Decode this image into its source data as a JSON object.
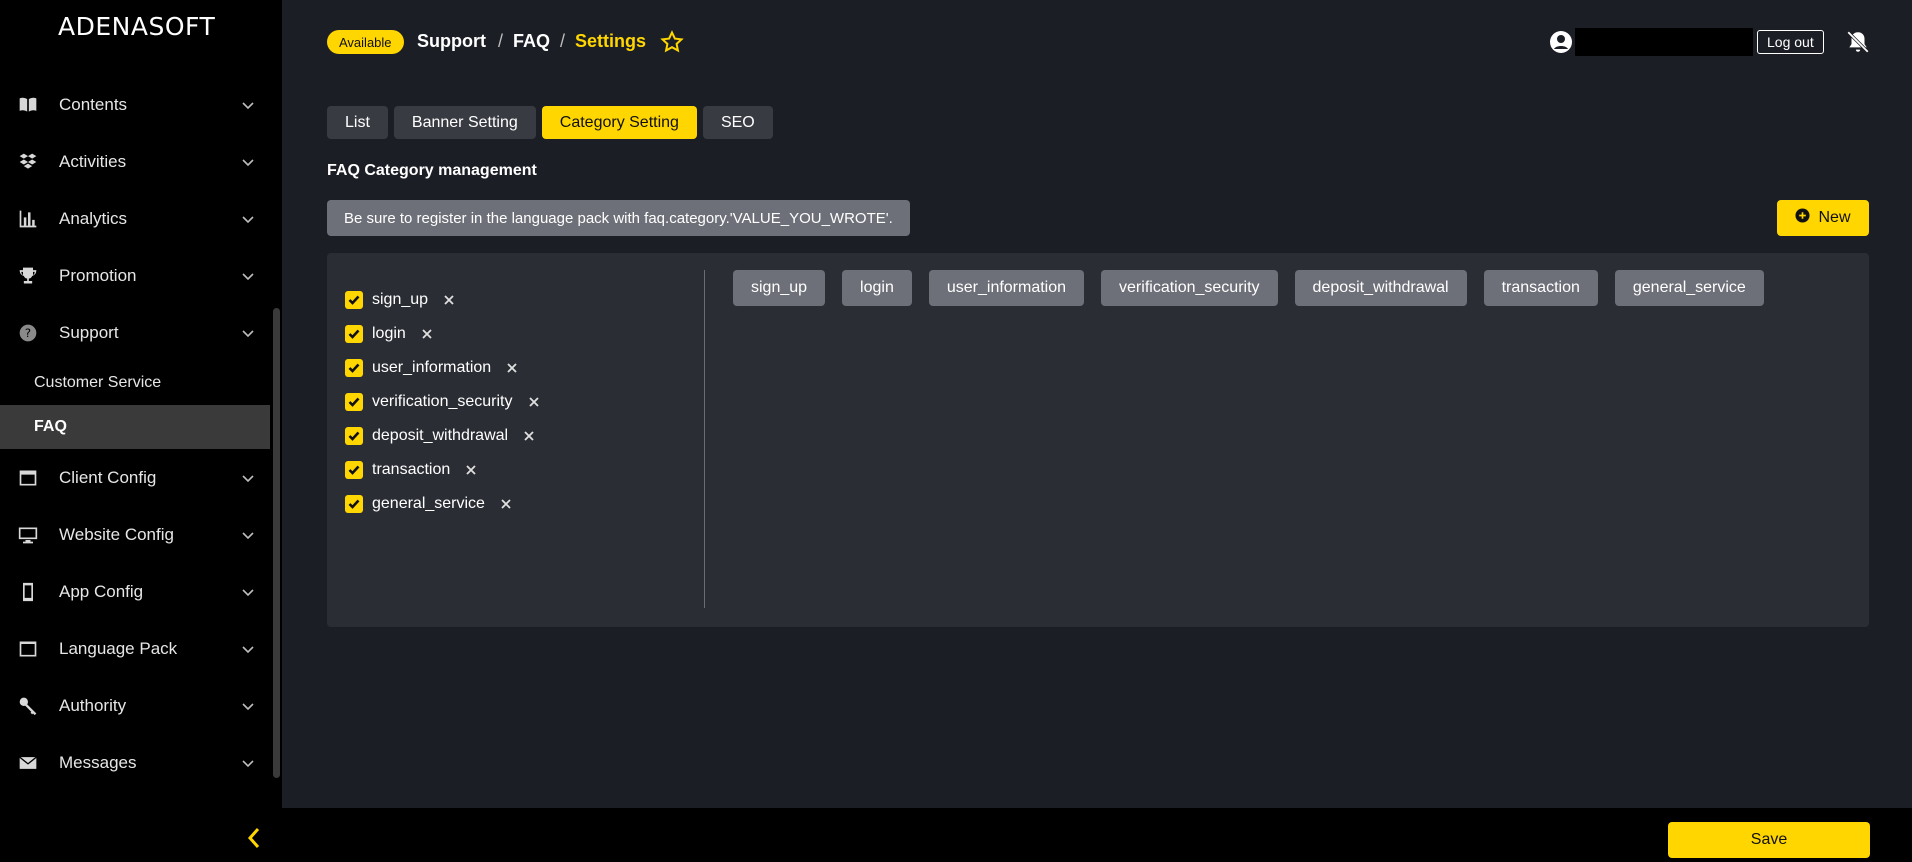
{
  "brand": {
    "logo": "ADENASOFT"
  },
  "sidebar": {
    "items": [
      {
        "label": "Contents",
        "icon": "book-icon"
      },
      {
        "label": "Activities",
        "icon": "dropbox-icon"
      },
      {
        "label": "Analytics",
        "icon": "bar-chart-icon"
      },
      {
        "label": "Promotion",
        "icon": "trophy-icon"
      },
      {
        "label": "Support",
        "icon": "question-circle-icon",
        "expanded": true
      }
    ],
    "support_children": [
      {
        "label": "Customer Service"
      },
      {
        "label": "FAQ",
        "active": true
      }
    ],
    "items_after": [
      {
        "label": "Client Config",
        "icon": "window-icon"
      },
      {
        "label": "Website Config",
        "icon": "monitor-icon"
      },
      {
        "label": "App Config",
        "icon": "mobile-icon"
      },
      {
        "label": "Language Pack",
        "icon": "archive-icon"
      },
      {
        "label": "Authority",
        "icon": "key-icon"
      },
      {
        "label": "Messages",
        "icon": "envelope-icon"
      }
    ]
  },
  "header": {
    "badge": "Available",
    "breadcrumb": [
      "Support",
      "/",
      "FAQ",
      "/",
      "Settings"
    ],
    "logout_label": "Log out"
  },
  "tabs": [
    {
      "label": "List",
      "active": false
    },
    {
      "label": "Banner Setting",
      "active": false
    },
    {
      "label": "Category Setting",
      "active": true
    },
    {
      "label": "SEO",
      "active": false
    }
  ],
  "main": {
    "title": "FAQ Category management",
    "notice": "Be sure to register in the language pack with faq.category.'VALUE_YOU_WROTE'.",
    "new_label": "New",
    "categories": [
      {
        "name": "sign_up",
        "checked": true
      },
      {
        "name": "login",
        "checked": true
      },
      {
        "name": "user_information",
        "checked": true
      },
      {
        "name": "verification_security",
        "checked": true
      },
      {
        "name": "deposit_withdrawal",
        "checked": true
      },
      {
        "name": "transaction",
        "checked": true
      },
      {
        "name": "general_service",
        "checked": true
      }
    ],
    "order_chips": [
      "sign_up",
      "login",
      "user_information",
      "verification_security",
      "deposit_withdrawal",
      "transaction",
      "general_service"
    ]
  },
  "footer": {
    "save_label": "Save"
  },
  "colors": {
    "accent": "#ffd600",
    "sidebar_bg": "#000000",
    "main_bg": "#1c1e26",
    "panel_bg": "#2b2d35",
    "chip_bg": "#6e7079"
  }
}
